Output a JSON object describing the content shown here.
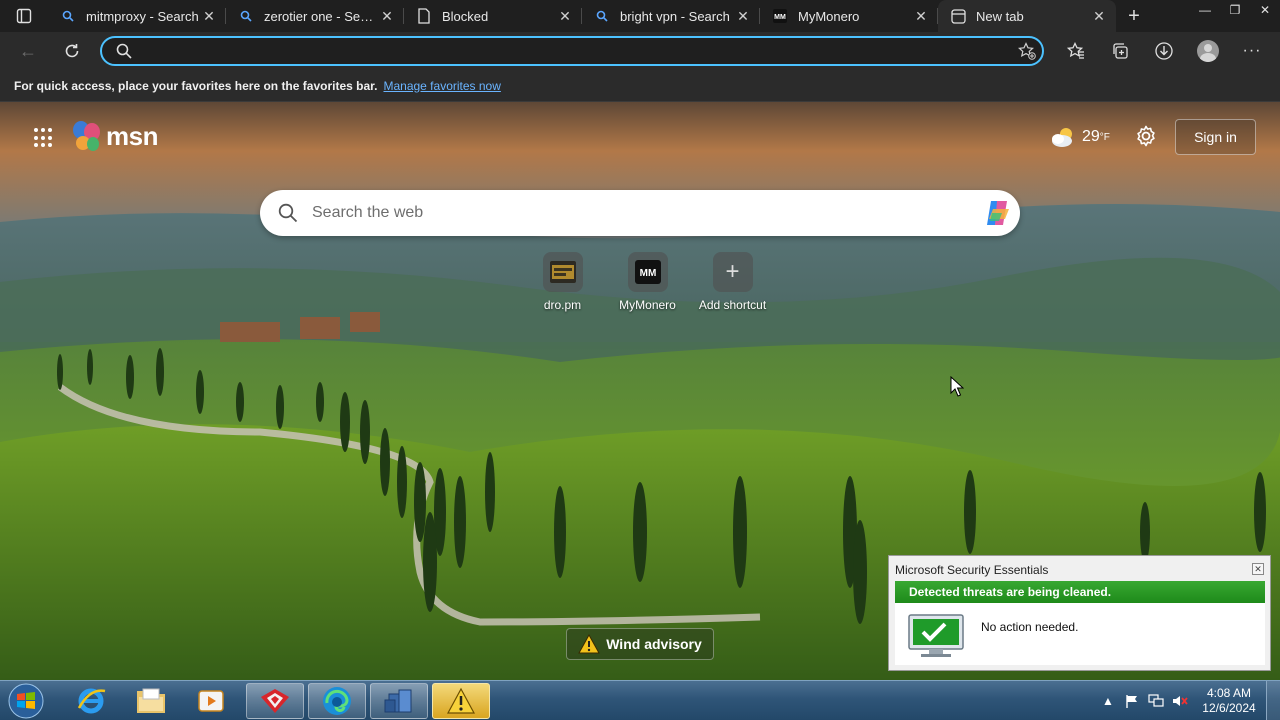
{
  "tabs": [
    {
      "label": "mitmproxy - Search",
      "icon": "search-icon"
    },
    {
      "label": "zerotier one - Search",
      "icon": "search-icon"
    },
    {
      "label": "Blocked",
      "icon": "document-icon"
    },
    {
      "label": "bright vpn - Search",
      "icon": "search-icon"
    },
    {
      "label": "MyMonero",
      "icon": "mymonero-icon"
    },
    {
      "label": "New tab",
      "icon": "newtab-icon",
      "active": true
    }
  ],
  "address_bar": {
    "value": "",
    "placeholder": ""
  },
  "favorites_bar": {
    "message": "For quick access, place your favorites here on the favorites bar.",
    "link": "Manage favorites now"
  },
  "msn": {
    "logo_text": "msn",
    "temperature": "29",
    "unit": "°F",
    "sign_in": "Sign in",
    "search_placeholder": "Search the web"
  },
  "shortcuts": [
    {
      "label": "dro.pm",
      "icon": "dropm-icon"
    },
    {
      "label": "MyMonero",
      "icon": "mymonero-icon"
    },
    {
      "label": "Add shortcut",
      "icon": "plus-icon"
    }
  ],
  "wind_advisory": "Wind advisory",
  "security_popup": {
    "title": "Microsoft Security Essentials",
    "banner": "Detected threats are being cleaned.",
    "status": "No action needed."
  },
  "taskbar": {
    "time": "4:08 AM",
    "date": "12/6/2024"
  },
  "colors": {
    "accent": "#4cc2ff",
    "link": "#6ab4ff",
    "security_green": "#1e8a1a"
  }
}
